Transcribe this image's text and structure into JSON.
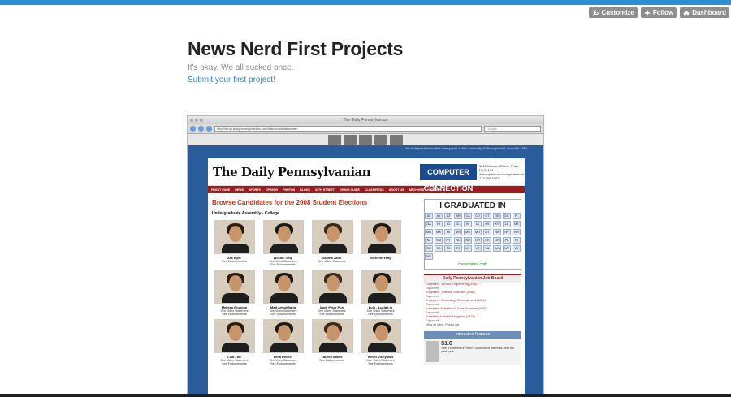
{
  "controls": {
    "customize": "Customize",
    "follow": "Follow",
    "dashboard": "Dashboard"
  },
  "blog": {
    "title": "News Nerd First Projects",
    "subtitle": "It's okay. We all sucked once.",
    "submit_link": "Submit your first project!"
  },
  "screenshot": {
    "window_title": "The Daily Pennsylvanian",
    "url": "http://tamp.dailypennsylvanian.com/sac/brand/alecenter/",
    "search_placeholder": "Google",
    "tagline": "the independent student newspaper of the University of Pennsylvania, founded 1885",
    "masthead": "The Daily Pennsylvanian",
    "ad_title": "COMPUTER CONNECTION",
    "ad_address": "3610 Sansom Street, Phila, PA 19104 www.upenn.edu/computerstore 215.898.5282",
    "nav": [
      "FRONT PAGE",
      "NEWS",
      "SPORTS",
      "OPINION",
      "PHOTOS",
      "BLOGS",
      "34TH STREET",
      "DINING GUIDE",
      "CLASSIFIEDS",
      "ABOUT US",
      "ARCHIVES",
      "SEARCH"
    ],
    "browse_heading": "Browse Candidates for the 2008 Student Elections",
    "ua_heading": "Undergraduate Assembly - College",
    "candidates": [
      {
        "name": "Zac Byer",
        "sub1": "See Endorsements",
        "sub2": ""
      },
      {
        "name": "Wilson Tong",
        "sub1": "See Video Statement",
        "sub2": "See Endorsements"
      },
      {
        "name": "Sakina Zaidi",
        "sub1": "See Video Statement",
        "sub2": ""
      },
      {
        "name": "Michelle Yang",
        "sub1": "",
        "sub2": ""
      },
      {
        "name": "Melissa Rudman",
        "sub1": "See Video Statement",
        "sub2": "See Endorsements"
      },
      {
        "name": "Matt Amodifiano",
        "sub1": "See Video Statement",
        "sub2": "See Endorsements"
      },
      {
        "name": "Mark Peter Pun",
        "sub1": "See Video Statement",
        "sub2": "See Endorsements"
      },
      {
        "name": "Lulu - Lucia Liu",
        "sub1": "See Video Statement",
        "sub2": "See Endorsements"
      },
      {
        "name": "Lisa Zhu",
        "sub1": "See Video Statement",
        "sub2": "See Endorsements"
      },
      {
        "name": "Leila Decker",
        "sub1": "See Video Statement",
        "sub2": "See Endorsements"
      },
      {
        "name": "Lauren Albert",
        "sub1": "See Endorsements",
        "sub2": ""
      },
      {
        "name": "Kevin Vichyastit",
        "sub1": "See Video Statement",
        "sub2": "See Endorsements"
      }
    ],
    "grad_title": "I GRADUATED IN",
    "states": [
      "AL",
      "AK",
      "AZ",
      "AR",
      "CA",
      "CO",
      "CT",
      "DE",
      "DC",
      "FL",
      "GA",
      "HI",
      "ID",
      "IL",
      "IN",
      "IA",
      "KS",
      "KY",
      "LA",
      "ME",
      "MD",
      "MA",
      "MI",
      "MN",
      "MS",
      "MO",
      "MT",
      "NE",
      "NV",
      "NH",
      "NJ",
      "NM",
      "NY",
      "NC",
      "ND",
      "OH",
      "OK",
      "OR",
      "PA",
      "RI",
      "SC",
      "SD",
      "TN",
      "TX",
      "UT",
      "VT",
      "VA",
      "WA",
      "WV",
      "WI",
      "WY"
    ],
    "classmates": "classmates.com",
    "job_board_title": "Daily Pennsylvanian Job Board",
    "jobs": [
      {
        "title": "Engineers, Vehicle Engineering (1982)",
        "co": "Exponent"
      },
      {
        "title": "Engineers, Thermal Sciences (1982)",
        "co": "Exponent"
      },
      {
        "title": "Engineers, Technology Development (1981)",
        "co": "Exponent"
      },
      {
        "title": "Scientists, Statistical & Data Sciences (1980)",
        "co": "Exponent"
      },
      {
        "title": "Scientists, Industrial Hygiene (1979)",
        "co": "Exponent"
      }
    ],
    "jobs_footer": "View all jobs · Post a job",
    "interactive_title": "interactive features",
    "interactive_text": "See a timeline of Penn's conflicts of interests over the past year.",
    "interactive_value": "$1.6"
  }
}
